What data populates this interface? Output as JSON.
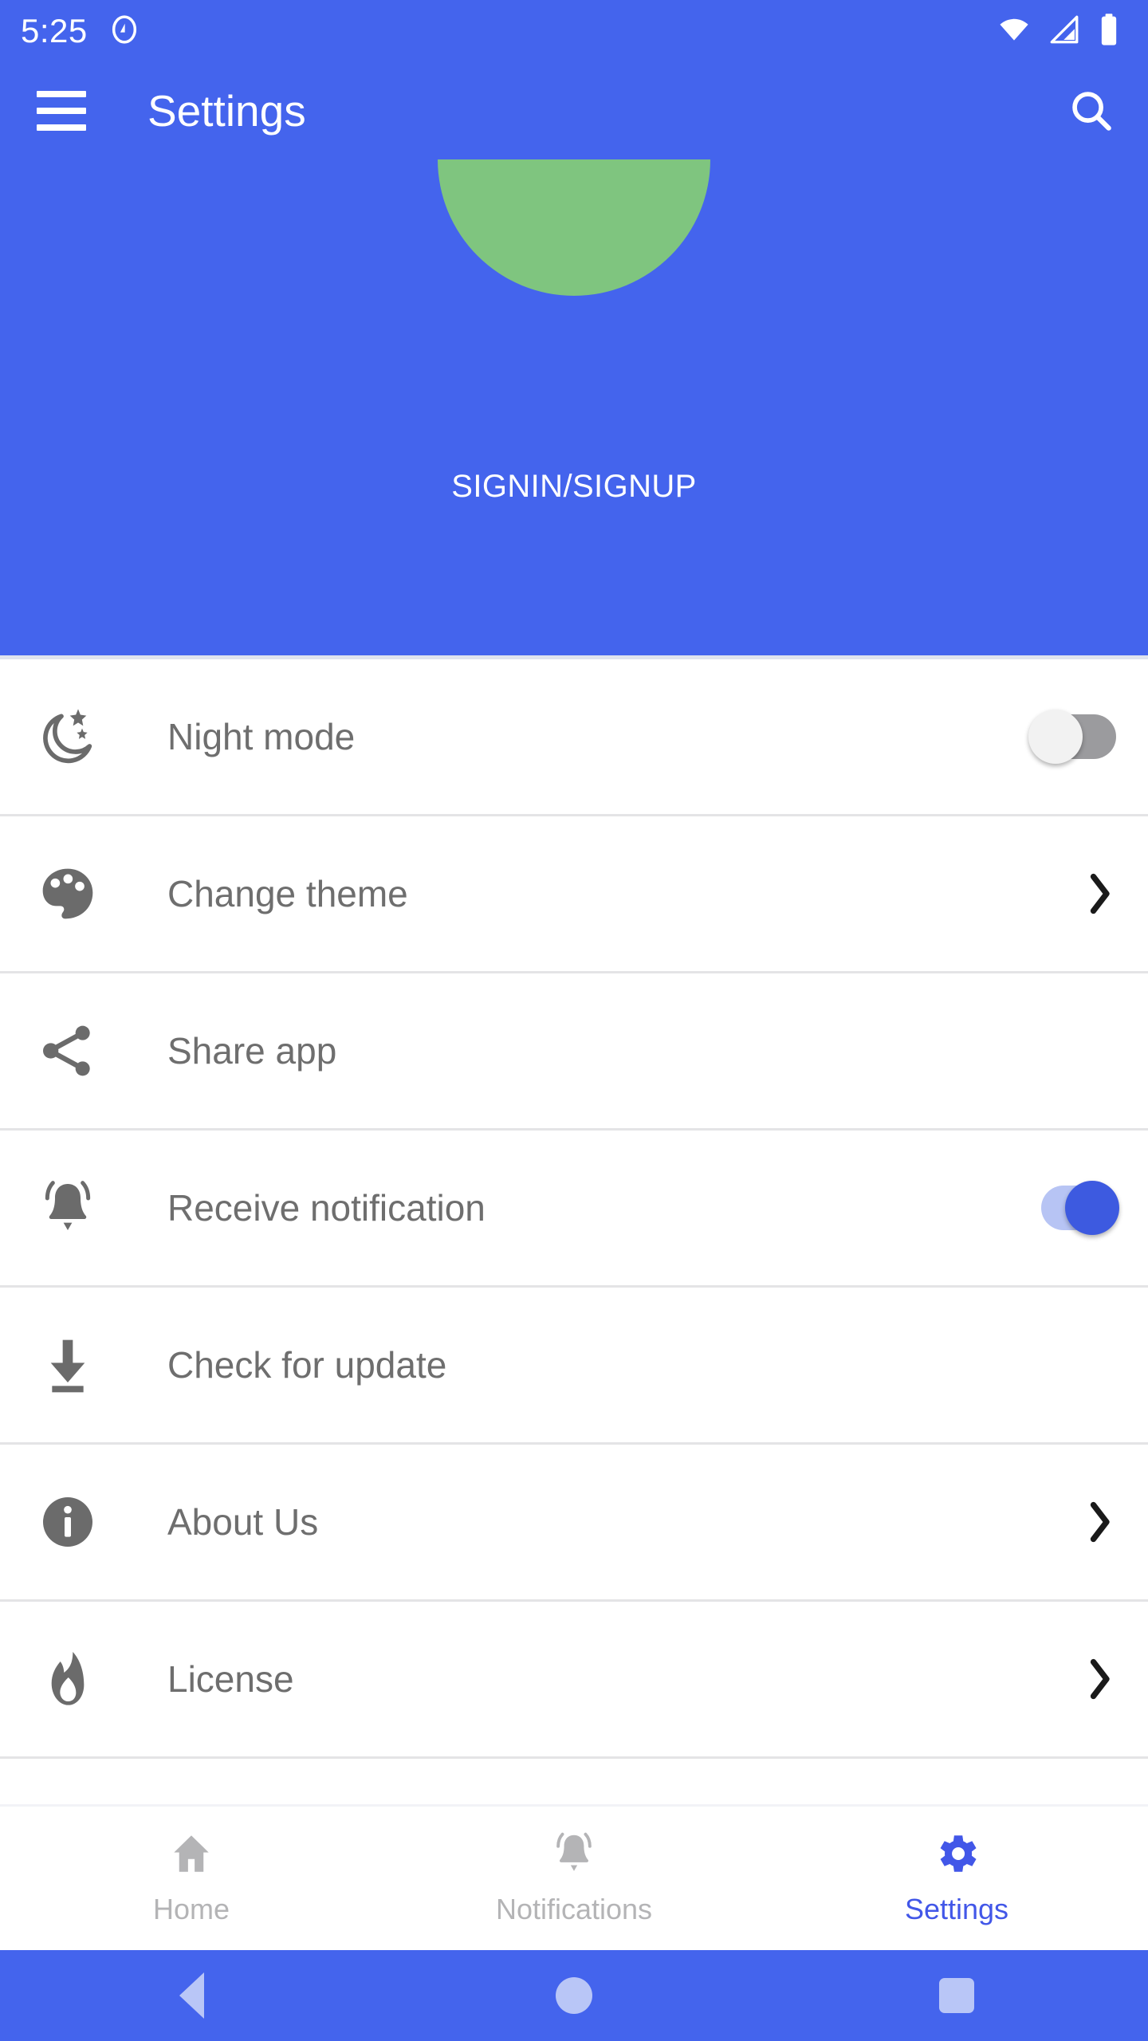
{
  "status_bar": {
    "time": "5:25",
    "icons": [
      "android-q-icon",
      "wifi-icon",
      "cellular-signal-icon",
      "battery-icon"
    ]
  },
  "appbar": {
    "menu_icon": "hamburger-menu-icon",
    "title": "Settings",
    "search_icon": "search-icon"
  },
  "header": {
    "avatar_icon": "profile-avatar",
    "avatar_color": "#7fc57f",
    "background_color": "#4464ed",
    "signin_label": "SIGNIN/SIGNUP"
  },
  "settings": {
    "rows": [
      {
        "label": "Night mode",
        "icon": "moon-stars-icon",
        "trailing": "toggle",
        "toggle_state": "off"
      },
      {
        "label": "Change theme",
        "icon": "palette-icon",
        "trailing": "chevron"
      },
      {
        "label": "Share app",
        "icon": "share-nodes-icon",
        "trailing": "none"
      },
      {
        "label": "Receive notification",
        "icon": "bell-ringing-icon",
        "trailing": "toggle",
        "toggle_state": "on"
      },
      {
        "label": "Check for update",
        "icon": "download-icon",
        "trailing": "none"
      },
      {
        "label": "About Us",
        "icon": "info-circle-icon",
        "trailing": "chevron"
      },
      {
        "label": "License",
        "icon": "flame-icon",
        "trailing": "chevron"
      }
    ]
  },
  "bottom_nav": {
    "active_color": "#4257e8",
    "inactive_color": "#b4b4b6",
    "items": [
      {
        "label": "Home",
        "icon": "home-icon",
        "active": false
      },
      {
        "label": "Notifications",
        "icon": "bell-icon",
        "active": false
      },
      {
        "label": "Settings",
        "icon": "gear-icon",
        "active": true
      }
    ]
  },
  "system_nav": {
    "back_icon": "back-triangle-icon",
    "home_icon": "home-circle-icon",
    "recents_icon": "recents-square-icon"
  }
}
